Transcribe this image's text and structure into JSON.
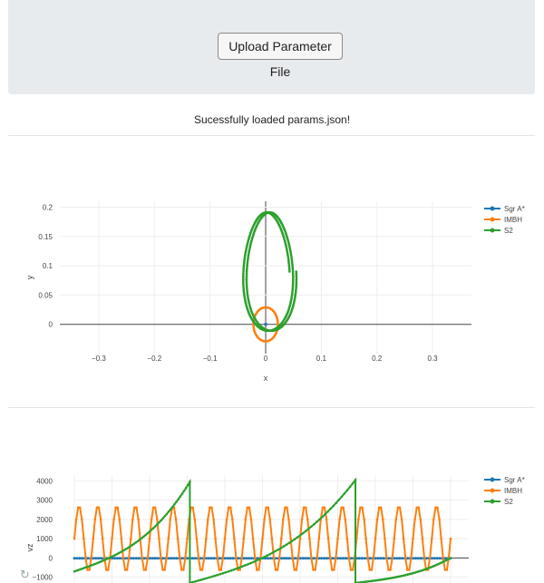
{
  "upload": {
    "button_label": "Upload Parameter File"
  },
  "status": {
    "message": "Sucessfully loaded params.json!"
  },
  "icons": {
    "reset": "reset-axes-icon"
  },
  "colors": {
    "sgr": "#1f77b4",
    "imbh": "#ff7f0e",
    "s2": "#2ca02c"
  },
  "chart_data": [
    {
      "type": "scatter",
      "mode": "lines+markers",
      "title": "",
      "xlabel": "x",
      "ylabel": "y",
      "xlim": [
        -0.37,
        0.37
      ],
      "ylim": [
        -0.05,
        0.21
      ],
      "xticks": [
        -0.3,
        -0.2,
        -0.1,
        0,
        0.1,
        0.2,
        0.3
      ],
      "xtick_labels": [
        "−0.3",
        "−0.2",
        "−0.1",
        "0",
        "0.1",
        "0.2",
        "0.3"
      ],
      "yticks": [
        0,
        0.05,
        0.1,
        0.15,
        0.2
      ],
      "ytick_labels": [
        "0",
        "0.05",
        "0.1",
        "0.15",
        "0.2"
      ],
      "grid": true,
      "legend": "right",
      "series": [
        {
          "name": "Sgr A*",
          "color": "#1f77b4",
          "points": [
            [
              0,
              0
            ]
          ]
        },
        {
          "name": "IMBH",
          "color": "#ff7f0e",
          "orbit": {
            "cx": 0,
            "cy": 0,
            "rx": 0.022,
            "ry": 0.029,
            "n": 48
          }
        },
        {
          "name": "S2",
          "color": "#2ca02c",
          "orbit": {
            "cx": 0.0,
            "cy": 0.09,
            "rx": 0.043,
            "ry": 0.101,
            "n": 220,
            "drift": 0.012,
            "turns": 2
          }
        }
      ]
    },
    {
      "type": "scatter",
      "mode": "lines+markers",
      "title": "",
      "xlabel": "",
      "ylabel": "vz",
      "xlim": [
        0,
        1
      ],
      "ylim": [
        -1300,
        4300
      ],
      "yticks": [
        -1000,
        0,
        1000,
        2000,
        3000,
        4000
      ],
      "ytick_labels": [
        "−1000",
        "0",
        "1000",
        "2000",
        "3000",
        "4000"
      ],
      "grid": true,
      "legend": "right",
      "series": [
        {
          "name": "Sgr A*",
          "color": "#1f77b4",
          "constant": -20
        },
        {
          "name": "IMBH",
          "color": "#ff7f0e",
          "sine": {
            "center": 1000,
            "amplitude": 1700,
            "cycles": 20
          }
        },
        {
          "name": "S2",
          "color": "#2ca02c",
          "segments": [
            {
              "x0": 0.0,
              "x1": 0.307,
              "y0": -700,
              "y1": 3950
            },
            {
              "x0": 0.307,
              "x1": 0.747,
              "y0": -1300,
              "y1": 4050
            },
            {
              "x0": 0.747,
              "x1": 1.0,
              "y0": -1300,
              "y1": 0
            }
          ]
        }
      ]
    }
  ]
}
